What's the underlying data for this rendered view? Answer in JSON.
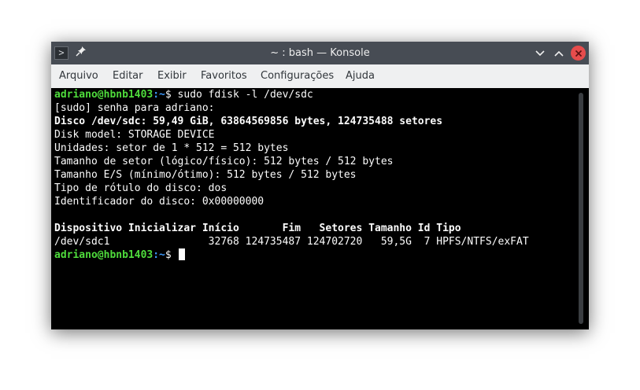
{
  "window": {
    "title": "~ : bash — Konsole"
  },
  "menu": {
    "items": [
      "Arquivo",
      "Editar",
      "Exibir",
      "Favoritos",
      "Configurações",
      "Ajuda"
    ]
  },
  "terminal": {
    "prompt_user": "adriano@hbnb1403",
    "prompt_path": ":~",
    "prompt_symbol": "$",
    "command": " sudo fdisk -l /dev/sdc",
    "lines": [
      "[sudo] senha para adriano:",
      "Disco /dev/sdc: 59,49 GiB, 63864569856 bytes, 124735488 setores",
      "Disk model: STORAGE DEVICE",
      "Unidades: setor de 1 * 512 = 512 bytes",
      "Tamanho de setor (lógico/físico): 512 bytes / 512 bytes",
      "Tamanho E/S (mínimo/ótimo): 512 bytes / 512 bytes",
      "Tipo de rótulo do disco: dos",
      "Identificador do disco: 0x00000000",
      "",
      "Dispositivo Inicializar Início       Fim   Setores Tamanho Id Tipo",
      "/dev/sdc1                32768 124735487 124702720   59,5G  7 HPFS/NTFS/exFAT"
    ]
  },
  "icons": {
    "terminal": "terminal-icon",
    "pin": "pin-icon",
    "minimize": "chevron-down-icon",
    "maximize": "chevron-up-icon",
    "close": "close-icon"
  },
  "colors": {
    "titlebar": "#474c54",
    "menubar": "#eff0f1",
    "terminal_bg": "#000000",
    "prompt_user": "#4fdc3c",
    "prompt_path": "#3d9bff",
    "close_button": "#e74c4c"
  }
}
